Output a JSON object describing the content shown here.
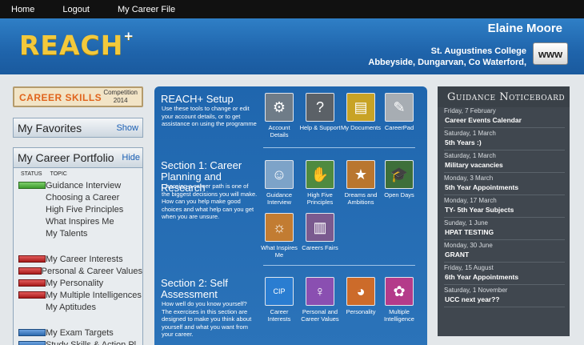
{
  "topnav": {
    "home": "Home",
    "logout": "Logout",
    "career_file": "My Career File"
  },
  "header": {
    "logo": "REACH",
    "logo_plus": "+",
    "user_name": "Elaine  Moore",
    "school": "St. Augustines College",
    "address": "Abbeyside, Dungarvan, Co Waterford,",
    "www": "www"
  },
  "career_skills": {
    "title": "CAREER SKILLS",
    "competition": "Competition",
    "year": "2014"
  },
  "favorites": {
    "title": "My Favorites",
    "show": "Show"
  },
  "portfolio": {
    "title": "My Career Portfolio",
    "hide": "Hide",
    "col_status": "STATUS",
    "col_topic": "TOPIC",
    "group1": [
      {
        "label": "Guidance Interview",
        "status": "green"
      },
      {
        "label": "Choosing a Career",
        "status": ""
      },
      {
        "label": "High Five Principles",
        "status": ""
      },
      {
        "label": "What Inspires Me",
        "status": ""
      },
      {
        "label": "My Talents",
        "status": ""
      }
    ],
    "group2": [
      {
        "label": "My Career Interests",
        "status": "red"
      },
      {
        "label": "Personal & Career Values",
        "status": "red"
      },
      {
        "label": "My Personality",
        "status": "red"
      },
      {
        "label": "My Multiple Intelligences",
        "status": "red"
      },
      {
        "label": "My Aptitudes",
        "status": ""
      }
    ],
    "group3": [
      {
        "label": "My Exam Targets",
        "status": "blue"
      },
      {
        "label": "Study Skills & Action Pl",
        "status": "blue"
      }
    ]
  },
  "setup": {
    "title": "REACH+ Setup",
    "desc": "Use these tools to change or edit your account details, or to get assistance on using the programme",
    "tools": [
      {
        "name": "Account Details",
        "icon": "gear-icon",
        "glyph": "⚙",
        "color": "#6f7c88"
      },
      {
        "name": "Help & Support",
        "icon": "question-icon",
        "glyph": "?",
        "color": "#5b6167"
      },
      {
        "name": "My Documents",
        "icon": "documents-icon",
        "glyph": "▤",
        "color": "#c8a325"
      },
      {
        "name": "CareerPad",
        "icon": "notepad-icon",
        "glyph": "✎",
        "color": "#a7adb3"
      }
    ]
  },
  "section1": {
    "title": "Section 1: Career Planning and Research",
    "desc": "Choosing a career path is one of the biggest decisions you will make. How can you help make good choices and what help can you get when you are unsure.",
    "tools": [
      {
        "name": "Guidance Interview",
        "icon": "interview-icon",
        "glyph": "☺",
        "color": "#7da3c8"
      },
      {
        "name": "High Five Principles",
        "icon": "hand-icon",
        "glyph": "✋",
        "color": "#4f8a3f"
      },
      {
        "name": "Dreams and Ambitions",
        "icon": "dreams-icon",
        "glyph": "★",
        "color": "#b9762f"
      },
      {
        "name": "Open Days",
        "icon": "graduate-icon",
        "glyph": "🎓",
        "color": "#3e6f3a"
      },
      {
        "name": "What Inspires Me",
        "icon": "inspire-icon",
        "glyph": "☼",
        "color": "#c27c32"
      },
      {
        "name": "Careers Fairs",
        "icon": "books-icon",
        "glyph": "▥",
        "color": "#7a5a8f"
      }
    ]
  },
  "section2": {
    "title": "Section 2: Self Assessment",
    "desc": "How well do you know yourself? The exercises in this section are designed to make you think about yourself and what you want from your career.",
    "tools": [
      {
        "name": "Career Interests",
        "icon": "cip-icon",
        "glyph": "CIP",
        "color": "#2a7dd1"
      },
      {
        "name": "Personal and Career Values",
        "icon": "values-icon",
        "glyph": "♀",
        "color": "#8a4fb1"
      },
      {
        "name": "Personality",
        "icon": "personality-icon",
        "glyph": "◕",
        "color": "#cc6b2a"
      },
      {
        "name": "Multiple Intelligence",
        "icon": "intelligence-icon",
        "glyph": "✿",
        "color": "#b43b8a"
      }
    ]
  },
  "noticeboard": {
    "title": "Guidance Noticeboard",
    "items": [
      {
        "date": "Friday, 7 February",
        "text": "Career Events Calendar"
      },
      {
        "date": "Saturday, 1 March",
        "text": "5th Years :)"
      },
      {
        "date": "Saturday, 1 March",
        "text": "Military vacancies"
      },
      {
        "date": "Monday, 3 March",
        "text": "5th Year Appointments"
      },
      {
        "date": "Monday, 17 March",
        "text": "TY- 5th Year Subjects"
      },
      {
        "date": "Sunday, 1 June",
        "text": "HPAT TESTING"
      },
      {
        "date": "Monday, 30 June",
        "text": "GRANT"
      },
      {
        "date": "Friday, 15 August",
        "text": "6th Year Appointments"
      },
      {
        "date": "Saturday, 1 November",
        "text": "UCC next year??"
      }
    ]
  }
}
